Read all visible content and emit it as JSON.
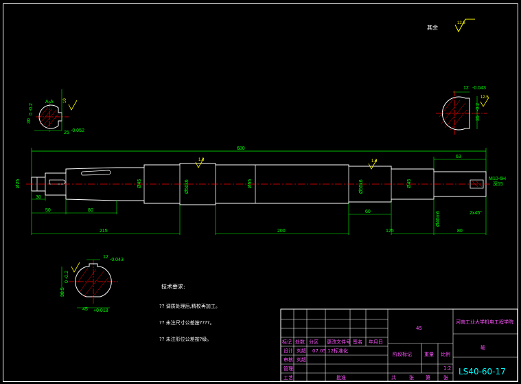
{
  "colors": {
    "background": "#000000",
    "outline": "#ffffff",
    "dimension": "#00ff00",
    "centerline": "#ff0000",
    "hatch": "#ff0000",
    "title_text": "#ff55ff",
    "title_alt": "#00ffff",
    "symbol": "#ffff00"
  },
  "roughness_note": {
    "label": "其余",
    "value": "12.5"
  },
  "section_views": {
    "a": {
      "label": "A-A",
      "width_dim": "25",
      "width_tol": "-0.052",
      "depth_dim": "30",
      "depth_tol": "0 -0.2",
      "roughness": "10"
    },
    "right": {
      "width_dim": "12",
      "width_tol": "-0.043",
      "depth_dim": "35",
      "depth_tol": "-0.2",
      "roughness": "12.5"
    },
    "bottom": {
      "width_dim": "12",
      "width_tol": "-0.043",
      "depth_dim": "38.5",
      "depth_tol": "0 -0.2",
      "dia_dim": "45",
      "dia_tol": "+0.018"
    }
  },
  "dimensions": {
    "overall": "680",
    "d25": "Ø25",
    "d45a": "Ø45",
    "d50": "Ø50k6",
    "d55": "Ø55",
    "d50b": "Ø50k6",
    "d45b": "Ø45",
    "d40": "Ø40m6",
    "seg_30": "30",
    "seg_50": "50",
    "seg_80": "80",
    "seg_215": "215",
    "seg_200": "200",
    "seg_60": "60",
    "seg_125": "125",
    "seg_63": "63",
    "seg_80b": "80",
    "thread": "M10-6H",
    "thread_depth": "深15",
    "chamfer": "2x45°",
    "rough_a": "1.6",
    "rough_b": "1.6"
  },
  "notes": {
    "title": "技术要求:",
    "lines": [
      "??  调质处理后,精校再加工。",
      "??  未注尺寸公差按????。",
      "??  未注形位公差按?级。"
    ]
  },
  "title_block": {
    "material": "45",
    "school": "河南工业大学机电工程学院",
    "part_name": "轴",
    "drawing_no": "LS40-60-17",
    "scale": "1:2",
    "row_headers": [
      "标记",
      "处数",
      "分区",
      "更改文件号",
      "签名",
      "年月日"
    ],
    "designer_label": "设计",
    "designer": "刘超",
    "date": "07.05.12",
    "standard_label": "标准化",
    "check_label": "审核",
    "checker": "刘超",
    "craft_label": "工艺",
    "approve_label": "批准",
    "stage_label": "阶段标记",
    "weight_label": "重量",
    "ratio_label": "比例",
    "sheet_total": "共",
    "sheet_unit": "张",
    "sheet_no": "第",
    "sheet_unit2": "张",
    "mgmt_label": "管理"
  }
}
